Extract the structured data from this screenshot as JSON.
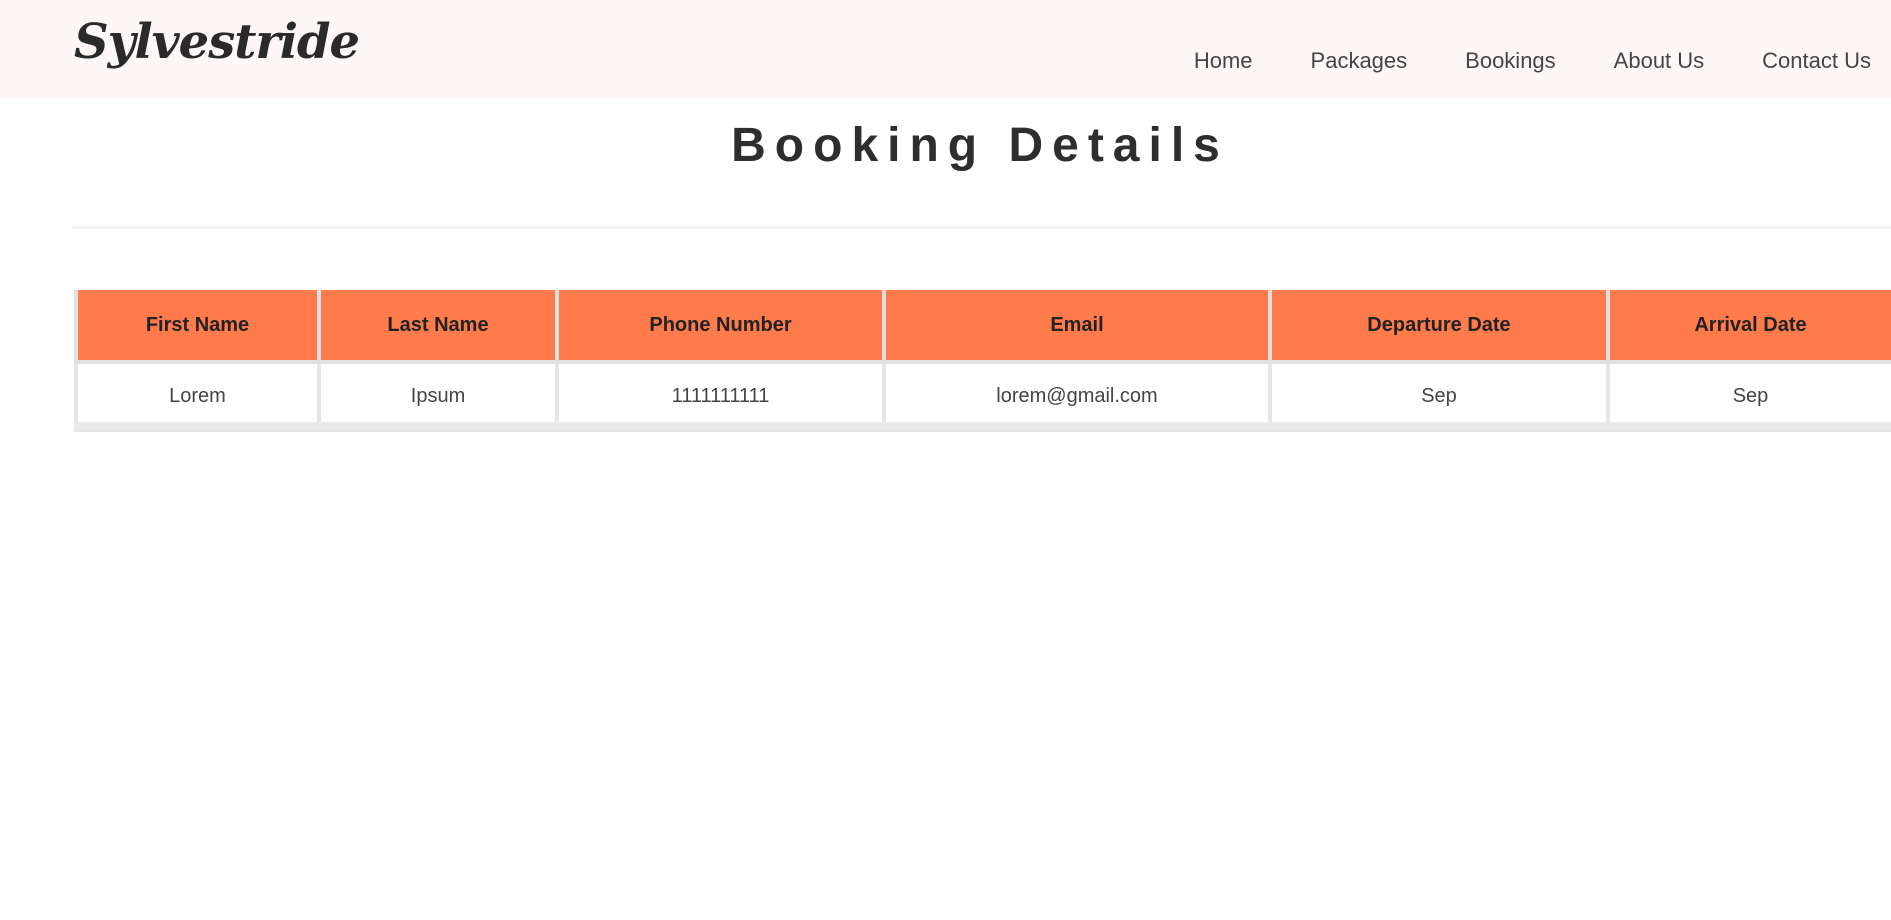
{
  "header": {
    "logo_text": "Sylvestride",
    "nav": [
      "Home",
      "Packages",
      "Bookings",
      "About Us",
      "Contact Us"
    ]
  },
  "main": {
    "title": "Booking Details",
    "table": {
      "columns": [
        "First Name",
        "Last Name",
        "Phone Number",
        "Email",
        "Departure Date",
        "Arrival Date"
      ],
      "rows": [
        [
          "Lorem",
          "Ipsum",
          "1111111111",
          "lorem@gmail.com",
          "Sep",
          "Sep"
        ]
      ]
    }
  },
  "colors": {
    "header_bg": "#fdf8f7",
    "table_header_bg": "#ff7b4c"
  }
}
